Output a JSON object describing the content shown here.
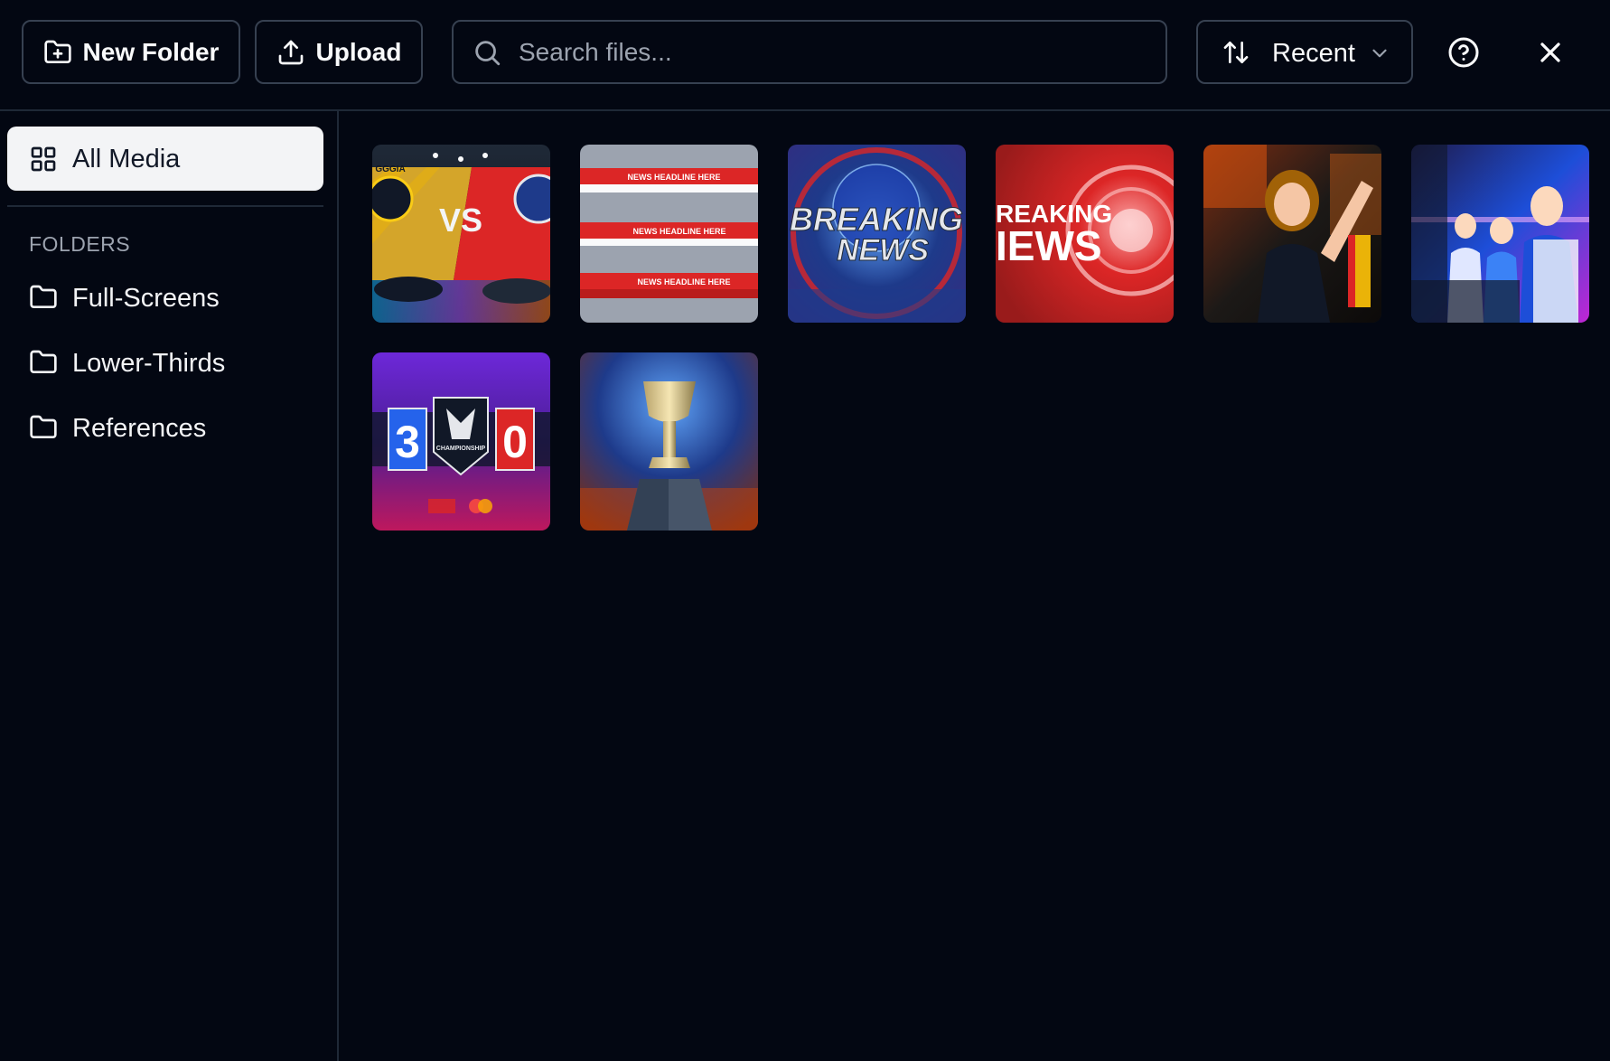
{
  "toolbar": {
    "new_folder_label": "New Folder",
    "upload_label": "Upload",
    "search_placeholder": "Search files...",
    "sort_label": "Recent"
  },
  "sidebar": {
    "all_media_label": "All Media",
    "folders_heading": "FOLDERS",
    "folders": [
      {
        "label": "Full-Screens"
      },
      {
        "label": "Lower-Thirds"
      },
      {
        "label": "References"
      }
    ]
  },
  "media": [
    {
      "kind": "versus-matchup",
      "center_text": "VS",
      "left_badge_text": "GGGIA"
    },
    {
      "kind": "lower-thirds-template",
      "headlines": [
        "NEWS HEADLINE HERE",
        "NEWS HEADLINE HERE",
        "NEWS HEADLINE HERE"
      ]
    },
    {
      "kind": "breaking-news-globe",
      "text_line1": "BREAKING",
      "text_line2": "NEWS"
    },
    {
      "kind": "breaking-news-red",
      "text_line1": "REAKING",
      "text_line2": "IEWS"
    },
    {
      "kind": "esports-player-cheering"
    },
    {
      "kind": "esports-team-playing"
    },
    {
      "kind": "scoreboard",
      "left_score": "3",
      "right_score": "0",
      "logo_text": "CHAMPIONSHIP"
    },
    {
      "kind": "trophy-on-stage"
    }
  ],
  "colors": {
    "background": "#030712",
    "border": "#374151",
    "divider": "#1f2937",
    "active_item_bg": "#f3f4f6",
    "muted_text": "#9ca3af"
  }
}
